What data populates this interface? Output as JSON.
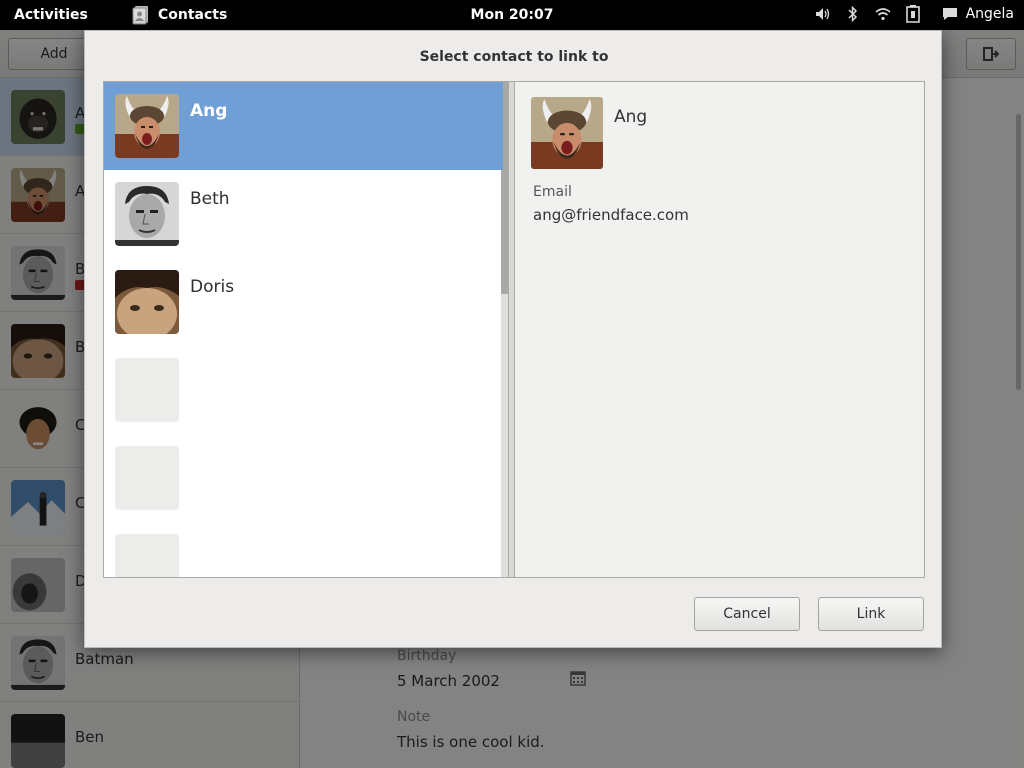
{
  "topbar": {
    "activities": "Activities",
    "app_name": "Contacts",
    "clock": "Mon 20:07",
    "user": "Angela",
    "icons": [
      "contacts-app-icon",
      "volume-icon",
      "bluetooth-icon",
      "wifi-icon",
      "battery-icon",
      "chat-icon"
    ]
  },
  "app": {
    "add_label": "Add",
    "sidebar": [
      {
        "name": "A",
        "avatar": "ape",
        "selected": true,
        "badge": "#5aa72b"
      },
      {
        "name": "A",
        "avatar": "horned"
      },
      {
        "name": "B",
        "avatar": "man",
        "badge": "#c92a2a"
      },
      {
        "name": "B",
        "avatar": "girl"
      },
      {
        "name": "C",
        "avatar": "curly"
      },
      {
        "name": "C",
        "avatar": "mountain"
      },
      {
        "name": "D",
        "avatar": "bw"
      },
      {
        "name": "Batman",
        "avatar": "man"
      },
      {
        "name": "Ben",
        "avatar": "dark"
      }
    ],
    "detail": {
      "birthday_label": "Birthday",
      "birthday_value": "5 March 2002",
      "note_label": "Note",
      "note_value": "This is one cool kid."
    }
  },
  "dialog": {
    "title": "Select contact to link to",
    "contacts": [
      {
        "name": "Ang",
        "avatar": "horned",
        "selected": true
      },
      {
        "name": "Beth",
        "avatar": "man"
      },
      {
        "name": "Doris",
        "avatar": "girl"
      }
    ],
    "empty_rows": 3,
    "preview": {
      "name": "Ang",
      "email_label": "Email",
      "email_value": "ang@friendface.com"
    },
    "cancel_label": "Cancel",
    "link_label": "Link"
  }
}
